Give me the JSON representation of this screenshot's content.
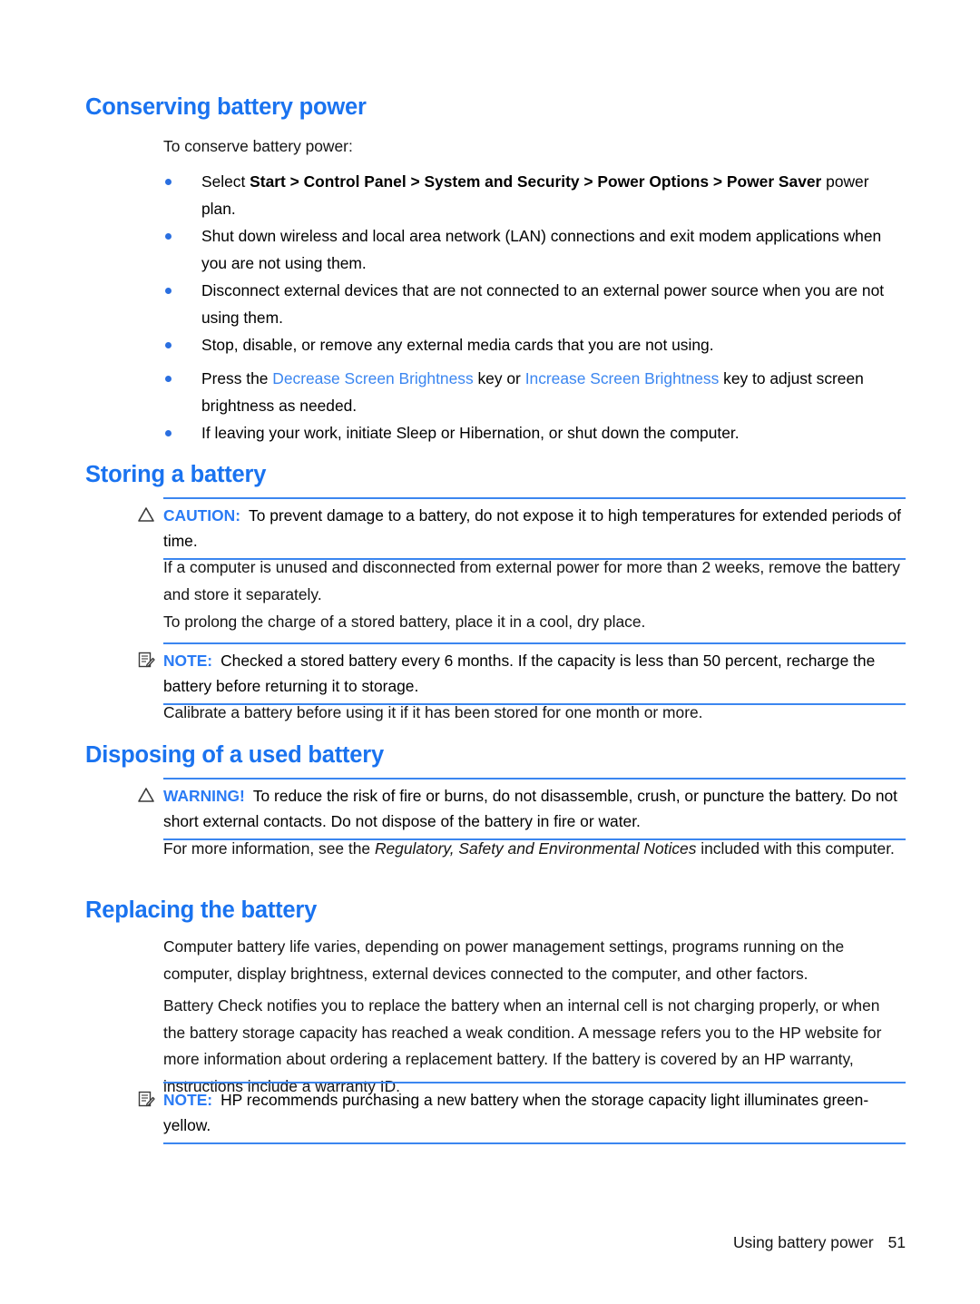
{
  "document": {
    "sections": [
      {
        "heading": "Conserving battery power",
        "intro": "To conserve battery power:",
        "bullets": [
          {
            "parts": [
              {
                "text": "Select ",
                "style": "normal"
              },
              {
                "text": "Start > Control Panel > System and Security > Power Options > Power Saver",
                "style": "bold"
              },
              {
                "text": " power plan.",
                "style": "normal"
              }
            ]
          },
          {
            "parts": [
              {
                "text": "Shut down wireless and local area network (LAN) connections and exit modem applications when you are not using them.",
                "style": "normal"
              }
            ]
          },
          {
            "parts": [
              {
                "text": "Disconnect external devices that are not connected to an external power source when you are not using them.",
                "style": "normal"
              }
            ]
          },
          {
            "parts": [
              {
                "text": "Stop, disable, or remove any external media cards that you are not using.",
                "style": "normal"
              }
            ]
          },
          {
            "parts": [
              {
                "text": "Press the ",
                "style": "normal"
              },
              {
                "text": "Decrease Screen Brightness",
                "style": "link"
              },
              {
                "text": " key or ",
                "style": "normal"
              },
              {
                "text": "Increase Screen Brightness",
                "style": "link"
              },
              {
                "text": " key to adjust screen brightness as needed.",
                "style": "normal"
              }
            ]
          },
          {
            "parts": [
              {
                "text": "If leaving your work, initiate Sleep or Hibernation, or shut down the computer.",
                "style": "normal"
              }
            ]
          }
        ]
      },
      {
        "heading": "Storing a battery",
        "caution": {
          "label": "CAUTION:",
          "icon": "warning-triangle-icon",
          "text": "To prevent damage to a battery, do not expose it to high temperatures for extended periods of time."
        },
        "paragraphs": [
          "If a computer is unused and disconnected from external power for more than 2 weeks, remove the battery and store it separately.",
          "To prolong the charge of a stored battery, place it in a cool, dry place."
        ],
        "note": {
          "label": "NOTE:",
          "icon": "note-icon",
          "text": "Checked a stored battery every 6 months. If the capacity is less than 50 percent, recharge the battery before returning it to storage."
        },
        "closing": "Calibrate a battery before using it if it has been stored for one month or more."
      },
      {
        "heading": "Disposing of a used battery",
        "warning": {
          "label": "WARNING!",
          "icon": "warning-triangle-icon",
          "text": "To reduce the risk of fire or burns, do not disassemble, crush, or puncture the battery. Do not short external contacts. Do not dispose of the battery in fire or water."
        },
        "closing_parts": [
          {
            "text": "For more information, see the ",
            "style": "normal"
          },
          {
            "text": "Regulatory, Safety and Environmental Notices",
            "style": "italic"
          },
          {
            "text": " included with this computer.",
            "style": "normal"
          }
        ]
      },
      {
        "heading": "Replacing the battery",
        "paragraphs": [
          "Computer battery life varies, depending on power management settings, programs running on the computer, display brightness, external devices connected to the computer, and other factors.",
          "Battery Check notifies you to replace the battery when an internal cell is not charging properly, or when the battery storage capacity has reached a weak condition. A message refers you to the HP website for more information about ordering a replacement battery. If the battery is covered by an HP warranty, instructions include a warranty ID."
        ],
        "note": {
          "label": "NOTE:",
          "icon": "note-icon",
          "text": "HP recommends purchasing a new battery when the storage capacity light illuminates green-yellow."
        }
      }
    ]
  },
  "footer": {
    "chapter": "Using battery power",
    "page_number": "51"
  },
  "colors": {
    "heading_blue": "#1a73f0",
    "link_blue": "#3b86f0",
    "rule_blue": "#3b86f0",
    "bullet_blue": "#2a6fe0",
    "body_text": "#141414"
  }
}
